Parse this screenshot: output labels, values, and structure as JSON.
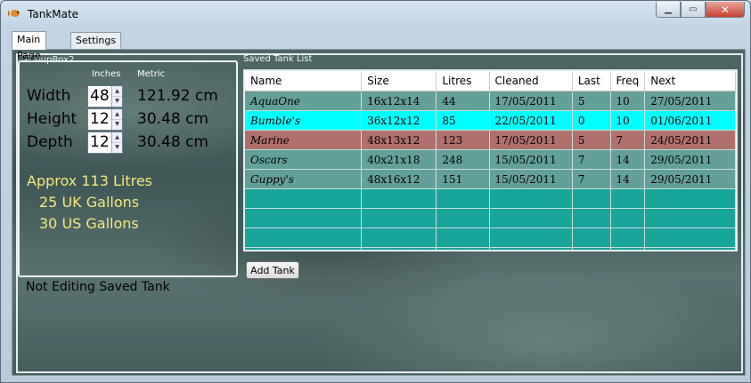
{
  "window": {
    "title": "TankMate"
  },
  "tabs": [
    {
      "label": "Main Page"
    },
    {
      "label": "Settings"
    }
  ],
  "groupbox": {
    "title": "GroupBox2",
    "col_inches": "Inches",
    "col_metric": "Metric",
    "rows": [
      {
        "label": "Width",
        "value": "48",
        "metric": "121.92 cm"
      },
      {
        "label": "Height",
        "value": "12",
        "metric": "30.48 cm"
      },
      {
        "label": "Depth",
        "value": "12",
        "metric": "30.48 cm"
      }
    ],
    "approx": "Approx 113 Litres",
    "uk": "25 UK Gallons",
    "us": "30 US Gallons"
  },
  "status": "Not Editing Saved Tank",
  "tank_list": {
    "title": "Saved Tank List",
    "columns": [
      "Name",
      "Size",
      "Litres",
      "Cleaned",
      "Last",
      "Freq",
      "Next"
    ],
    "rows": [
      {
        "cells": [
          "AquaOne",
          "16x12x14",
          "44",
          "17/05/2011",
          "5",
          "10",
          "27/05/2011"
        ],
        "color": "#64a09a"
      },
      {
        "cells": [
          "Bumble's",
          "36x12x12",
          "85",
          "22/05/2011",
          "0",
          "10",
          "01/06/2011"
        ],
        "color": "#00ffff"
      },
      {
        "cells": [
          "Marine",
          "48x13x12",
          "123",
          "17/05/2011",
          "5",
          "7",
          "24/05/2011"
        ],
        "color": "#b0706c"
      },
      {
        "cells": [
          "Oscars",
          "40x21x18",
          "248",
          "15/05/2011",
          "7",
          "14",
          "29/05/2011"
        ],
        "color": "#64a09a"
      },
      {
        "cells": [
          "Guppy's",
          "48x16x12",
          "151",
          "15/05/2011",
          "7",
          "14",
          "29/05/2011"
        ],
        "color": "#64a09a"
      }
    ],
    "empty_row_color": "#18a59a",
    "add_button": "Add Tank"
  }
}
